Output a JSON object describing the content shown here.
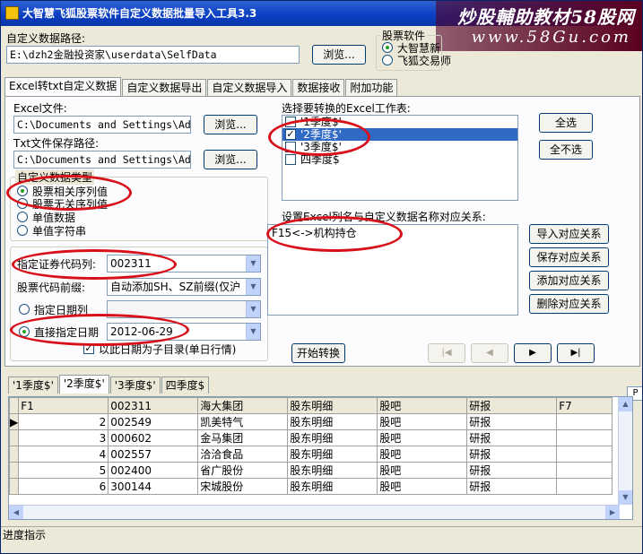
{
  "window": {
    "title": "大智慧飞狐股票软件自定义数据批量导入工具3.3"
  },
  "watermark": {
    "line1": "炒股輔助教材58股网",
    "line2": "www.58Gu.com"
  },
  "top": {
    "path_label": "自定义数据路径:",
    "path_value": "E:\\dzh2金融投资家\\userdata\\SelfData",
    "browse_label": "浏览...",
    "software_label": "股票软件",
    "software_options": [
      "大智慧新",
      "飞狐交易师"
    ]
  },
  "tabs": [
    "Excel转txt自定义数据",
    "自定义数据导出",
    "自定义数据导入",
    "数据接收",
    "附加功能"
  ],
  "excel": {
    "excel_file_label": "Excel文件:",
    "excel_file_value": "C:\\Documents and Settings\\Ad",
    "txt_path_label": "Txt文件保存路径:",
    "txt_path_value": "C:\\Documents and Settings\\Ad",
    "browse1": "浏览...",
    "browse2": "浏览...",
    "data_type_title": "自定义数据类型",
    "data_types": [
      "股票相关序列值",
      "股票无关序列值",
      "单值数据",
      "单值字符串"
    ],
    "code_col_label": "指定证券代码列:",
    "code_col_value": "002311",
    "prefix_label": "股票代码前缀:",
    "prefix_value": "自动添加SH、SZ前缀(仅沪",
    "date_col_label": "指定日期列",
    "date_direct_label": "直接指定日期",
    "date_value": "2012-06-29",
    "subdir_label": "以此日期为子目录(单日行情)"
  },
  "sheets": {
    "label": "选择要转换的Excel工作表:",
    "items": [
      {
        "name": "'1季度$'",
        "checked": false
      },
      {
        "name": "'2季度$'",
        "checked": true
      },
      {
        "name": "'3季度$'",
        "checked": false
      },
      {
        "name": "四季度$",
        "checked": false
      }
    ],
    "select_all": "全选",
    "select_none": "全不选"
  },
  "mapping": {
    "label": "设置Excel列名与自定义数据名称对应关系:",
    "value": "F15<->机构持仓",
    "buttons": [
      "导入对应关系",
      "保存对应关系",
      "添加对应关系",
      "删除对应关系"
    ]
  },
  "start_button": "开始转换",
  "nav": [
    "|◀",
    "◀",
    "▶",
    "▶|"
  ],
  "sheet_tabs": [
    "'1季度$'",
    "'2季度$'",
    "'3季度$'",
    "四季度$"
  ],
  "grid": {
    "columns": [
      "F1",
      "002311",
      "海大集团",
      "股东明细",
      "股吧",
      "研报",
      "F7"
    ],
    "rows": [
      [
        "2",
        "002549",
        "凯美特气",
        "股东明细",
        "股吧",
        "研报",
        ""
      ],
      [
        "3",
        "000602",
        "金马集团",
        "股东明细",
        "股吧",
        "研报",
        ""
      ],
      [
        "4",
        "002557",
        "洽洽食品",
        "股东明细",
        "股吧",
        "研报",
        ""
      ],
      [
        "5",
        "002400",
        "省广股份",
        "股东明细",
        "股吧",
        "研报",
        ""
      ],
      [
        "6",
        "300144",
        "宋城股份",
        "股东明细",
        "股吧",
        "研报",
        ""
      ]
    ]
  },
  "status": {
    "label": "进度指示"
  },
  "colors": {
    "highlight": "#316ac5",
    "annotation": "#d8101a",
    "titlebar": "#0a3ec2"
  }
}
